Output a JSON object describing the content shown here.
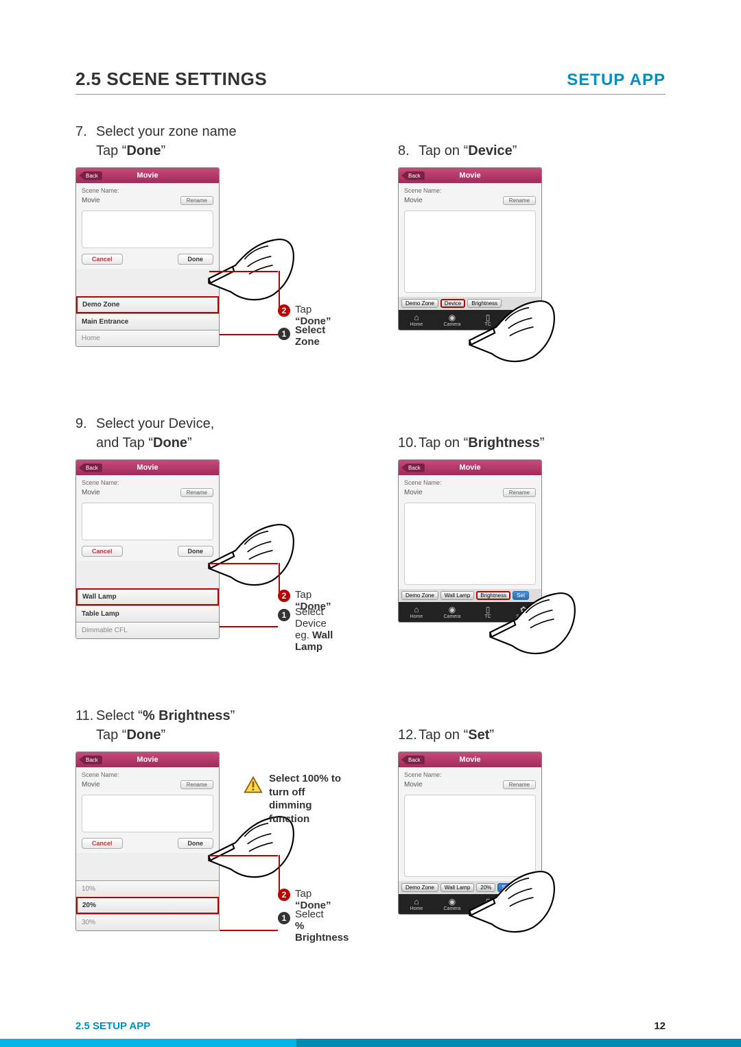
{
  "header": {
    "section": "2.5 SCENE SETTINGS",
    "app": "SETUP APP"
  },
  "footer": {
    "left": "2.5 SETUP APP",
    "page": "12"
  },
  "steps": {
    "s7": {
      "num": "7.",
      "line1": "Select your zone name",
      "line2_pre": "Tap “",
      "line2_b": "Done",
      "line2_post": "”"
    },
    "s8": {
      "num": "8.",
      "pre": "Tap on “",
      "b": "Device",
      "post": "”"
    },
    "s9": {
      "num": "9.",
      "line1": "Select your Device,",
      "line2_pre": "and Tap “",
      "line2_b": "Done",
      "line2_post": "”"
    },
    "s10": {
      "num": "10.",
      "pre": "Tap on “",
      "b": "Brightness",
      "post": "”"
    },
    "s11": {
      "num": "11.",
      "line1_pre": "Select “",
      "line1_b": "% Brightness",
      "line1_post": "”",
      "line2_pre": "Tap “",
      "line2_b": "Done",
      "line2_post": "”"
    },
    "s12": {
      "num": "12.",
      "pre": "Tap on “",
      "b": "Set",
      "post": "”"
    }
  },
  "mock": {
    "back": "Back",
    "title": "Movie",
    "scene_name_label": "Scene Name:",
    "scene_name_value": "Movie",
    "rename": "Rename",
    "cancel": "Cancel",
    "done": "Done",
    "zones": {
      "demo": "Demo Zone",
      "main": "Main Entrance",
      "home": "Home"
    },
    "devices": {
      "wall": "Wall Lamp",
      "table": "Table Lamp",
      "cfl": "Dimmable CFL"
    },
    "pct": {
      "p10": "10%",
      "p20": "20%",
      "p30": "30%"
    },
    "crumb": {
      "device": "Device",
      "brightness": "Brightness",
      "set": "Set",
      "walllamp": "Wall Lamp",
      "pct20": "20%"
    },
    "tabbar": {
      "home": "Home",
      "camera": "Camera",
      "tc": "TC",
      "setting": "Setting"
    }
  },
  "callouts": {
    "tap_done_pre": "Tap ",
    "tap_done_b": "“Done”",
    "select_zone_b1": "Select",
    "select_zone_b2": "Zone",
    "select_device_l1": "Select",
    "select_device_l2": "Device",
    "select_device_eg_pre": "eg. ",
    "select_device_eg_b": "Wall Lamp",
    "select_pct_l1": "Select",
    "select_pct_l2": "% Brightness",
    "warn_l1": "Select 100% to turn off",
    "warn_l2": "dimming function"
  }
}
